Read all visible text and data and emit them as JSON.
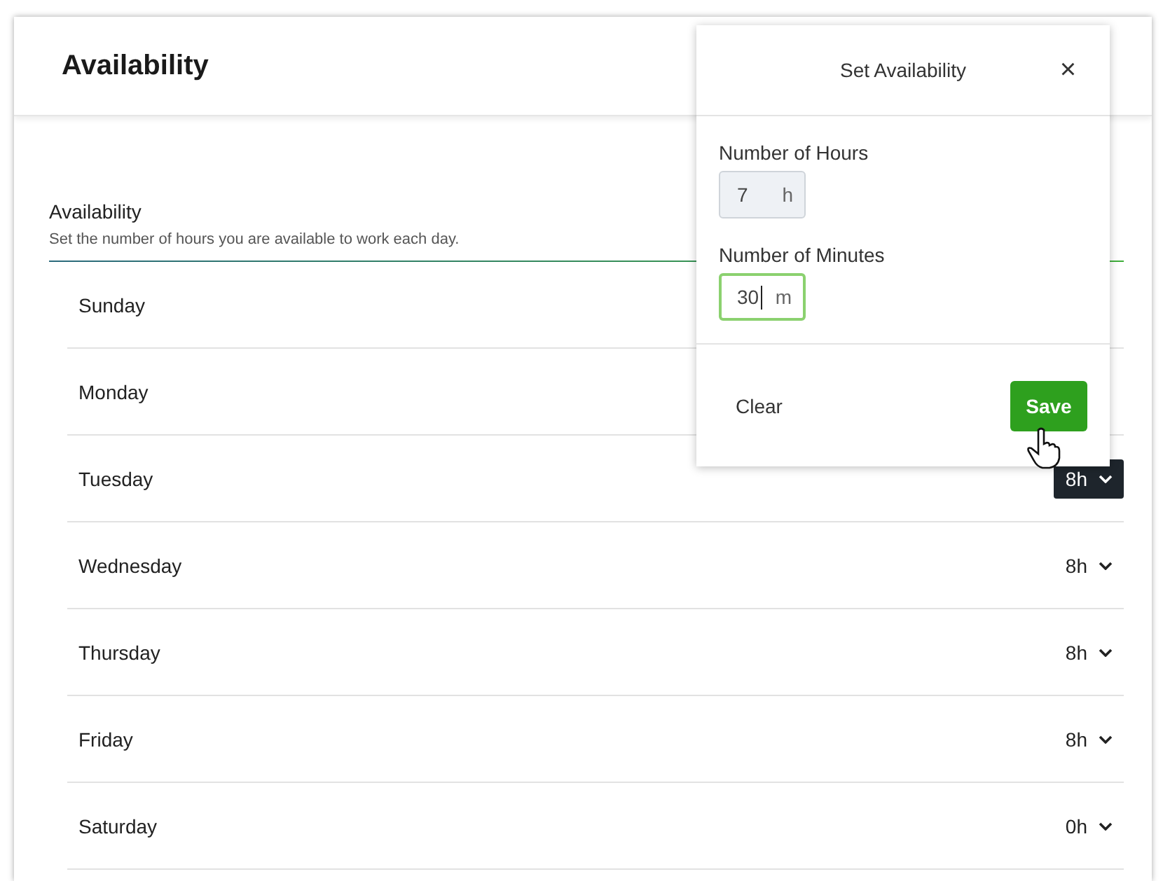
{
  "page": {
    "title": "Availability"
  },
  "section": {
    "title": "Availability",
    "description": "Set the number of hours you are available to work each day."
  },
  "days": [
    {
      "name": "Sunday"
    },
    {
      "name": "Monday"
    },
    {
      "name": "Tuesday",
      "value": "8h",
      "selected": true
    },
    {
      "name": "Wednesday",
      "value": "8h",
      "selected": false
    },
    {
      "name": "Thursday",
      "value": "8h",
      "selected": false
    },
    {
      "name": "Friday",
      "value": "8h",
      "selected": false
    },
    {
      "name": "Saturday",
      "value": "0h",
      "selected": false
    }
  ],
  "popover": {
    "title": "Set Availability",
    "close": "×",
    "fields": [
      {
        "label": "Number of Hours",
        "value": "7",
        "unit": "h",
        "focused": false
      },
      {
        "label": "Number of Minutes",
        "value": "30",
        "unit": "m",
        "focused": true
      }
    ],
    "buttons": [
      {
        "label": "Clear",
        "kind": "link"
      },
      {
        "label": "Save",
        "kind": "primary"
      }
    ]
  }
}
